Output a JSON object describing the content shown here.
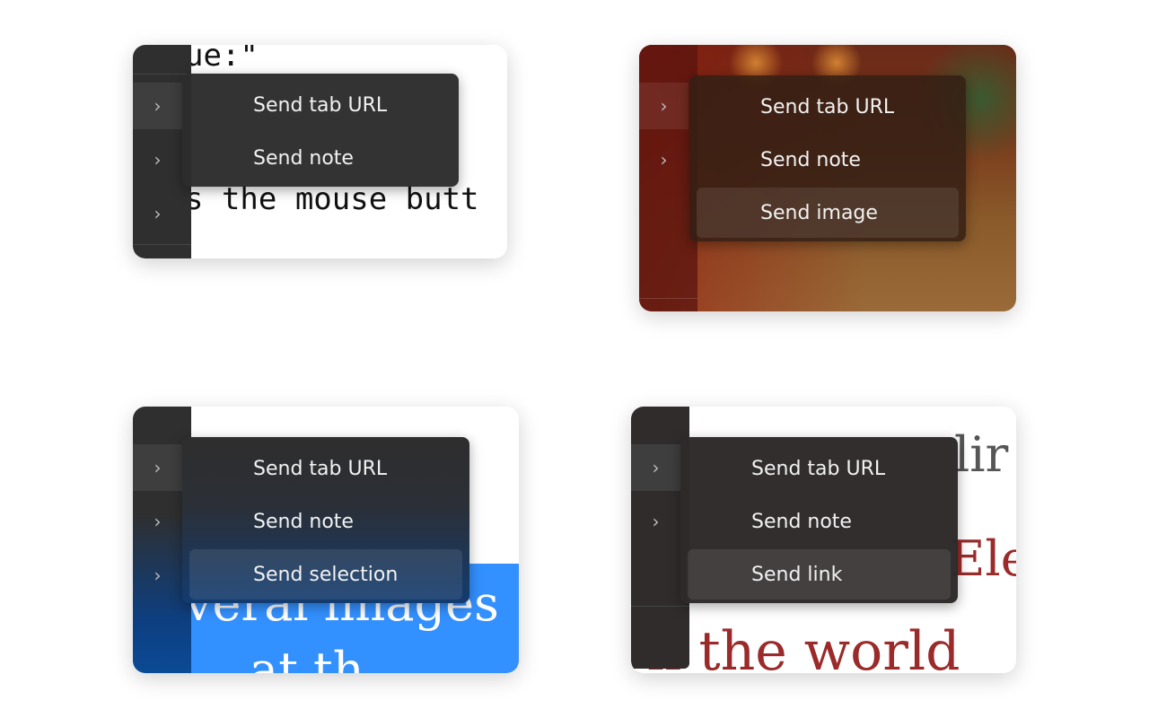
{
  "panels": [
    {
      "menu": [
        "Send tab URL",
        "Send note"
      ],
      "background_text": [
        "ue:\"",
        "s the mouse butt"
      ]
    },
    {
      "menu": [
        "Send tab URL",
        "Send note",
        "Send image"
      ],
      "background_text": []
    },
    {
      "menu": [
        "Send tab URL",
        "Send note",
        "Send selection"
      ],
      "background_text": [
        "veral images",
        "at th"
      ]
    },
    {
      "menu": [
        "Send tab URL",
        "Send note",
        "Send link"
      ],
      "background_text": [
        "lir",
        "Ele",
        "ll the world"
      ]
    }
  ],
  "icons": {
    "sidebar_chevron": "chevron-right-icon"
  },
  "colors": {
    "menu_bg": "#2c2c2c",
    "selection_blue": "#3390ff",
    "link_red": "#9b2a2a"
  }
}
